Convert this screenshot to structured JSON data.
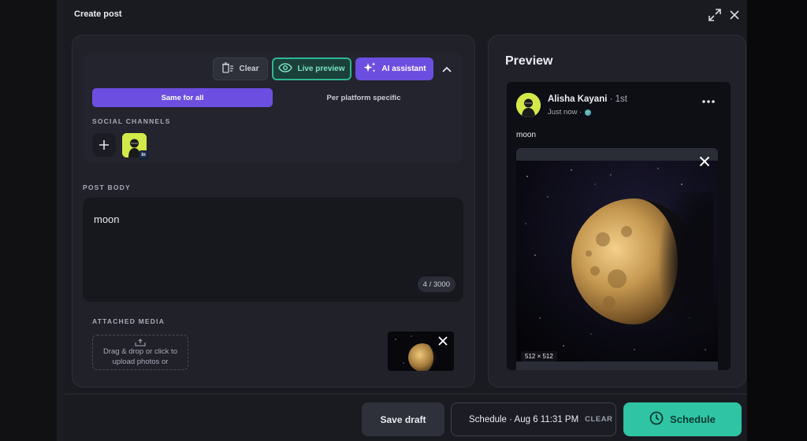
{
  "modal": {
    "title": "Create post"
  },
  "toolbar": {
    "clear_label": "Clear",
    "live_preview_label": "Live preview",
    "ai_assistant_label": "AI assistant"
  },
  "segment": {
    "same_for_all": "Same for all",
    "per_platform": "Per platform specific"
  },
  "social_channels": {
    "label": "SOCIAL CHANNELS",
    "badge": "in"
  },
  "post_body": {
    "label": "POST BODY",
    "text": "moon",
    "counter": "4 / 3000"
  },
  "attached_media": {
    "label": "ATTACHED MEDIA",
    "drop_line1": "Drag & drop or click to",
    "drop_line2": "upload photos or"
  },
  "preview": {
    "title": "Preview",
    "author": "Alisha Kayani",
    "degree": " · 1st",
    "time": "Just now ·",
    "body": "moon",
    "dimensions": "512 × 512"
  },
  "footer": {
    "save_draft": "Save draft",
    "schedule_info": "Schedule · Aug 6 11:31 PM",
    "clear": "CLEAR",
    "schedule": "Schedule"
  },
  "colors": {
    "accent_purple": "#6c4ee0",
    "accent_teal": "#2fc4a4",
    "panel": "#202129"
  }
}
